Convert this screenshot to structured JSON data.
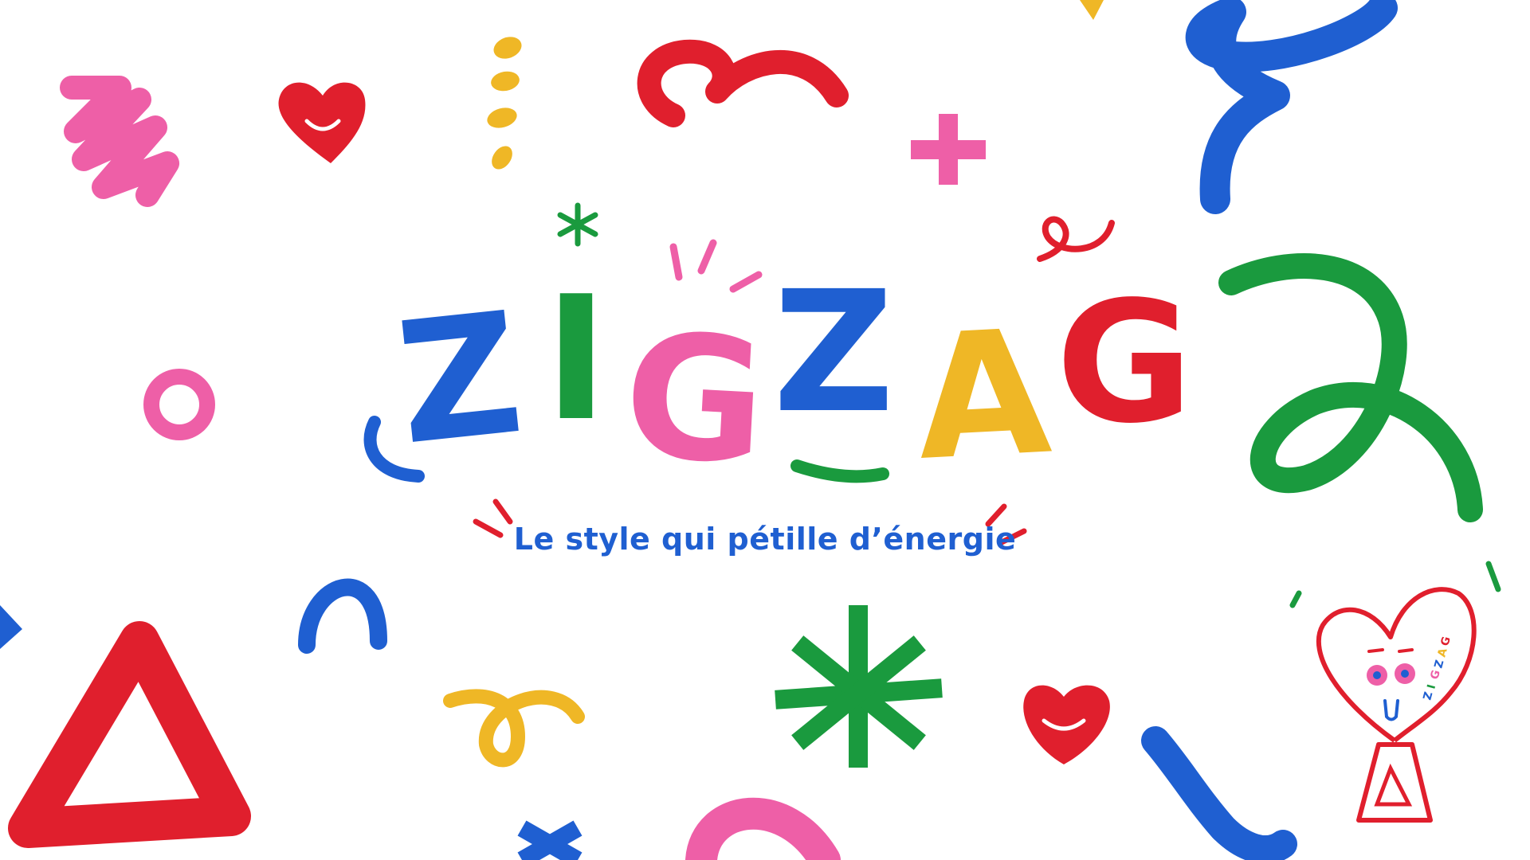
{
  "logo": {
    "letters": [
      {
        "char": "Z",
        "color": "#1f5fd1"
      },
      {
        "char": "I",
        "color": "#1a9a3e"
      },
      {
        "char": "G",
        "color": "#ee5fa7"
      },
      {
        "char": "Z",
        "color": "#1f5fd1"
      },
      {
        "char": "A",
        "color": "#efb726"
      },
      {
        "char": "G",
        "color": "#e01f2d"
      }
    ]
  },
  "tagline": {
    "text": "Le style qui pétille d’énergie",
    "color": "#1f5fd1"
  },
  "mascot": {
    "badge_letters": [
      {
        "char": "Z",
        "color": "#1f5fd1"
      },
      {
        "char": "I",
        "color": "#1a9a3e"
      },
      {
        "char": "G",
        "color": "#ee5fa7"
      },
      {
        "char": "Z",
        "color": "#1f5fd1"
      },
      {
        "char": "A",
        "color": "#efb726"
      },
      {
        "char": "G",
        "color": "#e01f2d"
      }
    ]
  },
  "palette": {
    "blue": "#1f5fd1",
    "green": "#1a9a3e",
    "pink": "#ee5fa7",
    "yellow": "#efb726",
    "red": "#e01f2d"
  },
  "icons": [
    "pink-scribble-icon",
    "red-smiling-heart-icon",
    "yellow-dots-icon",
    "red-squiggle-icon",
    "pink-plus-icon",
    "blue-wave-icon",
    "green-loop-icon",
    "pink-circle-icon",
    "red-curl-icon",
    "green-asterisk-icon",
    "blue-arch-icon",
    "red-triangle-icon",
    "yellow-loop-icon",
    "heart-mascot-icon"
  ]
}
